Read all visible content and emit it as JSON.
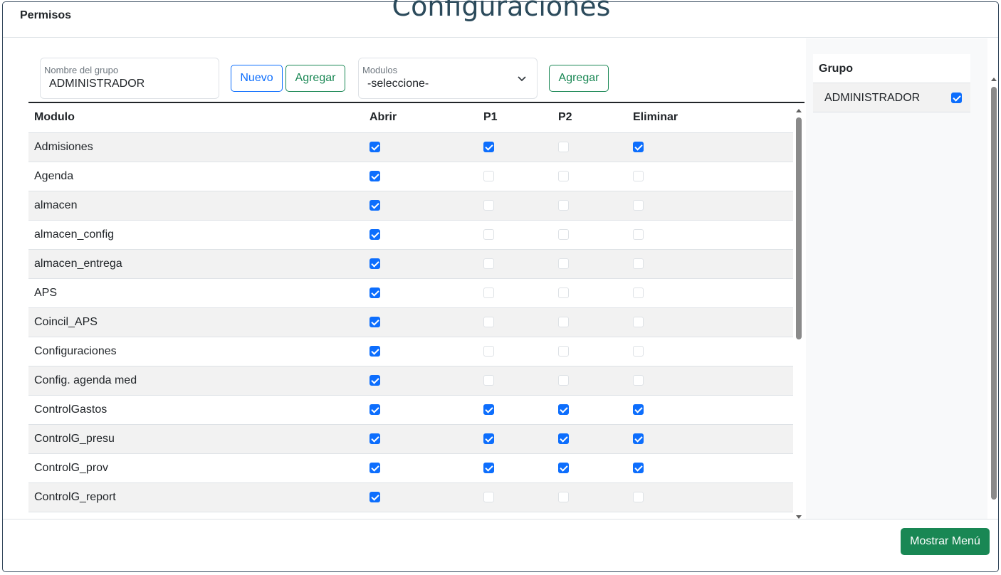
{
  "page": {
    "background_title": "Configuraciones"
  },
  "modal": {
    "title": "Permisos"
  },
  "form": {
    "group_name_label": "Nombre del grupo",
    "group_name_value": "ADMINISTRADOR",
    "new_button": "Nuevo",
    "add_group_button": "Agregar",
    "modules_label": "Modulos",
    "modules_selected": "-seleccione-",
    "add_module_button": "Agregar"
  },
  "table": {
    "headers": [
      "Modulo",
      "Abrir",
      "P1",
      "P2",
      "Eliminar"
    ],
    "rows": [
      {
        "modulo": "Admisiones",
        "abrir": true,
        "p1": true,
        "p2": false,
        "eliminar": true
      },
      {
        "modulo": "Agenda",
        "abrir": true,
        "p1": false,
        "p2": false,
        "eliminar": false
      },
      {
        "modulo": "almacen",
        "abrir": true,
        "p1": false,
        "p2": false,
        "eliminar": false
      },
      {
        "modulo": "almacen_config",
        "abrir": true,
        "p1": false,
        "p2": false,
        "eliminar": false
      },
      {
        "modulo": "almacen_entrega",
        "abrir": true,
        "p1": false,
        "p2": false,
        "eliminar": false
      },
      {
        "modulo": "APS",
        "abrir": true,
        "p1": false,
        "p2": false,
        "eliminar": false
      },
      {
        "modulo": "Coincil_APS",
        "abrir": true,
        "p1": false,
        "p2": false,
        "eliminar": false
      },
      {
        "modulo": "Configuraciones",
        "abrir": true,
        "p1": false,
        "p2": false,
        "eliminar": false
      },
      {
        "modulo": "Config. agenda med",
        "abrir": true,
        "p1": false,
        "p2": false,
        "eliminar": false
      },
      {
        "modulo": "ControlGastos",
        "abrir": true,
        "p1": true,
        "p2": true,
        "eliminar": true
      },
      {
        "modulo": "ControlG_presu",
        "abrir": true,
        "p1": true,
        "p2": true,
        "eliminar": true
      },
      {
        "modulo": "ControlG_prov",
        "abrir": true,
        "p1": true,
        "p2": true,
        "eliminar": true
      },
      {
        "modulo": "ControlG_report",
        "abrir": true,
        "p1": false,
        "p2": false,
        "eliminar": false
      },
      {
        "modulo": "",
        "abrir": false,
        "p1": false,
        "p2": false,
        "eliminar": false
      }
    ]
  },
  "groups": {
    "header": "Grupo",
    "items": [
      {
        "name": "ADMINISTRADOR",
        "checked": true
      }
    ]
  },
  "footer": {
    "show_menu_button": "Mostrar Menú"
  },
  "colors": {
    "primary": "#0d6efd",
    "success": "#198754",
    "title": "#2b4a5b"
  }
}
